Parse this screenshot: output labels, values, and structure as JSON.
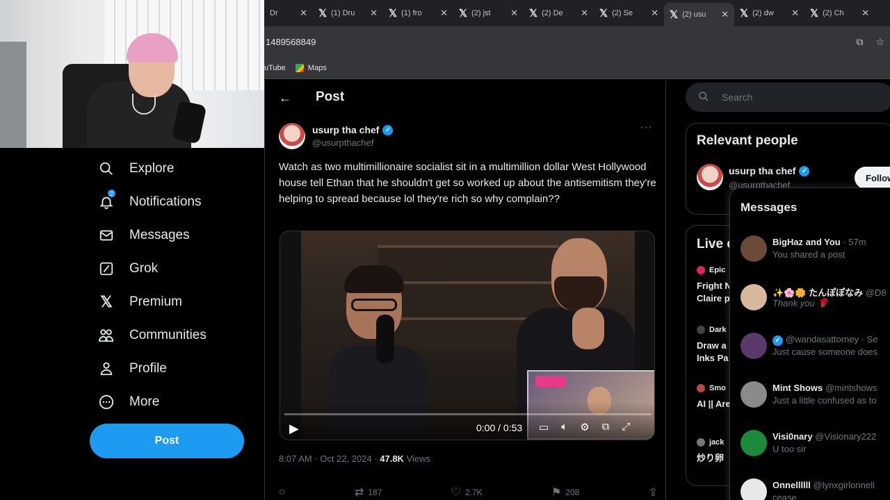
{
  "browser": {
    "tabs": [
      {
        "title": "Dr"
      },
      {
        "title": "(1) Dru"
      },
      {
        "title": "(1) fro"
      },
      {
        "title": "(2) jst"
      },
      {
        "title": "(2) De"
      },
      {
        "title": "(2) Se"
      },
      {
        "title": "(2) usu"
      },
      {
        "title": "(2) dw"
      },
      {
        "title": "(2) Ch"
      }
    ],
    "active_tab_index": 6,
    "url_fragment": "1489568849",
    "bookmarks": [
      "uTube",
      "Maps"
    ]
  },
  "nav": {
    "items": [
      {
        "label": "Explore",
        "icon": "search-icon"
      },
      {
        "label": "Notifications",
        "icon": "bell-icon"
      },
      {
        "label": "Messages",
        "icon": "envelope-icon"
      },
      {
        "label": "Grok",
        "icon": "grok-icon"
      },
      {
        "label": "Premium",
        "icon": "x-logo-icon"
      },
      {
        "label": "Communities",
        "icon": "people-icon"
      },
      {
        "label": "Profile",
        "icon": "person-icon"
      },
      {
        "label": "More",
        "icon": "more-circle-icon"
      }
    ],
    "notification_count": "2",
    "post_button": "Post"
  },
  "post": {
    "header_title": "Post",
    "author_name": "usurp tha chef",
    "author_handle": "@usurpthachef",
    "text": "Watch as two multimillionaire socialist sit in a multimillion dollar West Hollywood house tell Ethan that he shouldn't get so worked up about the antisemitism they're helping to spread because lol they're rich so why complain??",
    "video": {
      "time": "0:00 / 0:53",
      "progress": 0.0
    },
    "timestamp": "8:07 AM · Oct 22, 2024 · ",
    "views_count": "47.8K",
    "views_label": " Views",
    "actions": {
      "reposts": "187",
      "likes": "2.7K",
      "bookmarks": "208"
    }
  },
  "sidebar": {
    "search_placeholder": "Search",
    "relevant_title": "Relevant people",
    "relevant_person": {
      "name": "usurp tha chef",
      "handle": "@usurpthachef",
      "follow": "Follow"
    },
    "live_title": "Live o",
    "live_items": [
      {
        "meta": "Epic",
        "title_line1": "Fright N",
        "title_line2": "Claire p",
        "dot_color": "#e0245e"
      },
      {
        "meta": "Dark",
        "title_line1": "Draw a",
        "title_line2": "Inks Pa",
        "dot_color": "#444"
      },
      {
        "meta": "Smo",
        "title_line1": "AI || Are",
        "title_line2": "",
        "dot_color": "#b04a4a"
      },
      {
        "meta": "jack",
        "title_line1": "炒り卵",
        "title_line2": "",
        "dot_color": "#777"
      }
    ]
  },
  "messages": {
    "title": "Messages",
    "items": [
      {
        "name": "BigHaz and You",
        "meta": " · 57m",
        "preview": "You shared a post",
        "avatar_color": "#6b4a3a"
      },
      {
        "name": "✨🌸🌼 たんぽぽなみ",
        "meta": " @D8",
        "preview": "Thank you 🌹",
        "avatar_color": "#d8b89a"
      },
      {
        "name": "",
        "meta": "@wandasattorney · Se",
        "preview": "Just cause someone does",
        "avatar_color": "#5a3a6a"
      },
      {
        "name": "Mint Shows",
        "meta": " @mintshows",
        "preview": "Just a little confused as to",
        "avatar_color": "#8a8a8a"
      },
      {
        "name": "Visi0nary",
        "meta": " @Visionary222",
        "preview": "U too sir",
        "avatar_color": "#1d8a3a"
      },
      {
        "name": "Onnellllll",
        "meta": " @lynxgirlonnell",
        "preview": "cease",
        "avatar_color": "#e8e8e8"
      }
    ]
  }
}
